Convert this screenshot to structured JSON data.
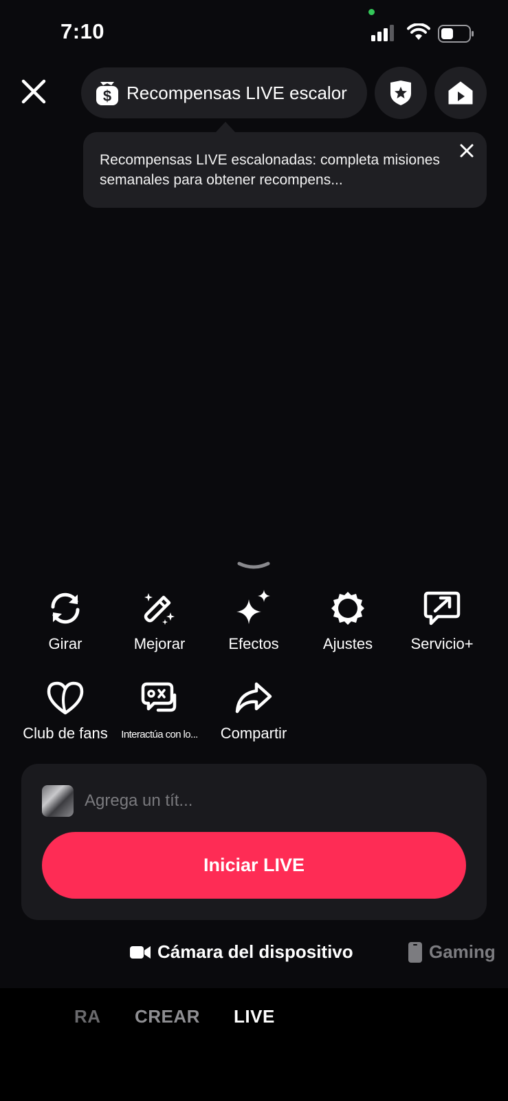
{
  "status_bar": {
    "time": "7:10"
  },
  "header": {
    "reward_pill_label": "Recompensas LIVE escalor",
    "tooltip_text": "Recompensas LIVE escalonadas: completa misiones semanales para obtener recompens..."
  },
  "tools": [
    {
      "label": "Girar",
      "icon": "rotate-icon"
    },
    {
      "label": "Mejorar",
      "icon": "magic-wand-icon"
    },
    {
      "label": "Efectos",
      "icon": "sparkles-icon"
    },
    {
      "label": "Ajustes",
      "icon": "settings-gear-icon"
    },
    {
      "label": "Servicio+",
      "icon": "service-chat-arrow-icon"
    },
    {
      "label": "Club de fans",
      "icon": "heart-icon"
    },
    {
      "label": "Interactúa con lo...",
      "icon": "game-chat-icon"
    },
    {
      "label": "Compartir",
      "icon": "share-arrow-icon"
    }
  ],
  "panel": {
    "title_placeholder": "Agrega un tít...",
    "start_button": "Iniciar LIVE"
  },
  "sources": {
    "active": "Cámara del dispositivo",
    "inactive": "Gaming"
  },
  "modes": {
    "edge": "RA",
    "crear": "CREAR",
    "live": "LIVE"
  },
  "colors": {
    "background": "#0a0a0d",
    "accent": "#fe2c55",
    "surface": "#1f1f23",
    "muted_text": "#8e8e92"
  }
}
